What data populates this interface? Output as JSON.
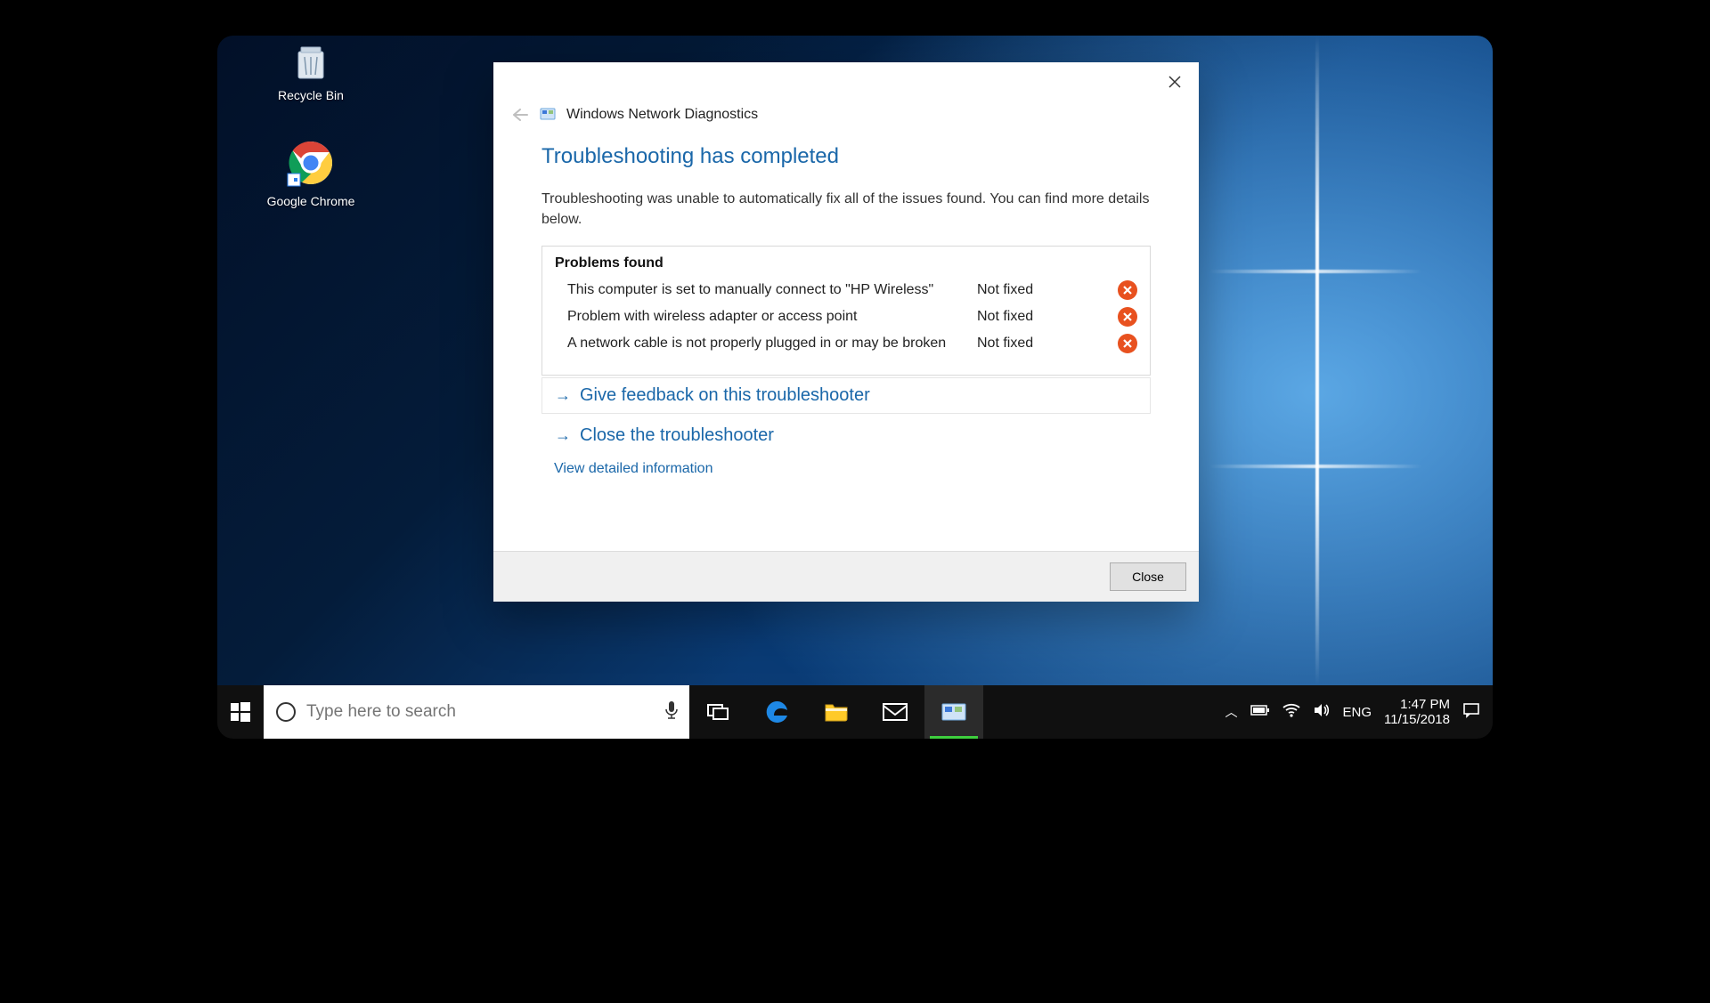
{
  "desktop": {
    "icons": [
      {
        "name": "recycle-bin",
        "label": "Recycle Bin"
      },
      {
        "name": "google-chrome",
        "label": "Google Chrome"
      }
    ]
  },
  "dialog": {
    "title": "Windows Network Diagnostics",
    "heading": "Troubleshooting has completed",
    "lead": "Troubleshooting was unable to automatically fix all of the issues found. You can find more details below.",
    "problems_header": "Problems found",
    "problems": [
      {
        "desc": "This computer is set to manually connect to \"HP Wireless\"",
        "status": "Not fixed"
      },
      {
        "desc": "Problem with wireless adapter or access point",
        "status": "Not fixed"
      },
      {
        "desc": "A network cable is not properly plugged in or may be broken",
        "status": "Not fixed"
      }
    ],
    "actions": {
      "feedback": "Give feedback on this troubleshooter",
      "close_ts": "Close the troubleshooter",
      "detailed": "View detailed information"
    },
    "close_button": "Close"
  },
  "taskbar": {
    "search_placeholder": "Type here to search",
    "tray": {
      "language": "ENG",
      "time": "1:47 PM",
      "date": "11/15/2018"
    }
  }
}
